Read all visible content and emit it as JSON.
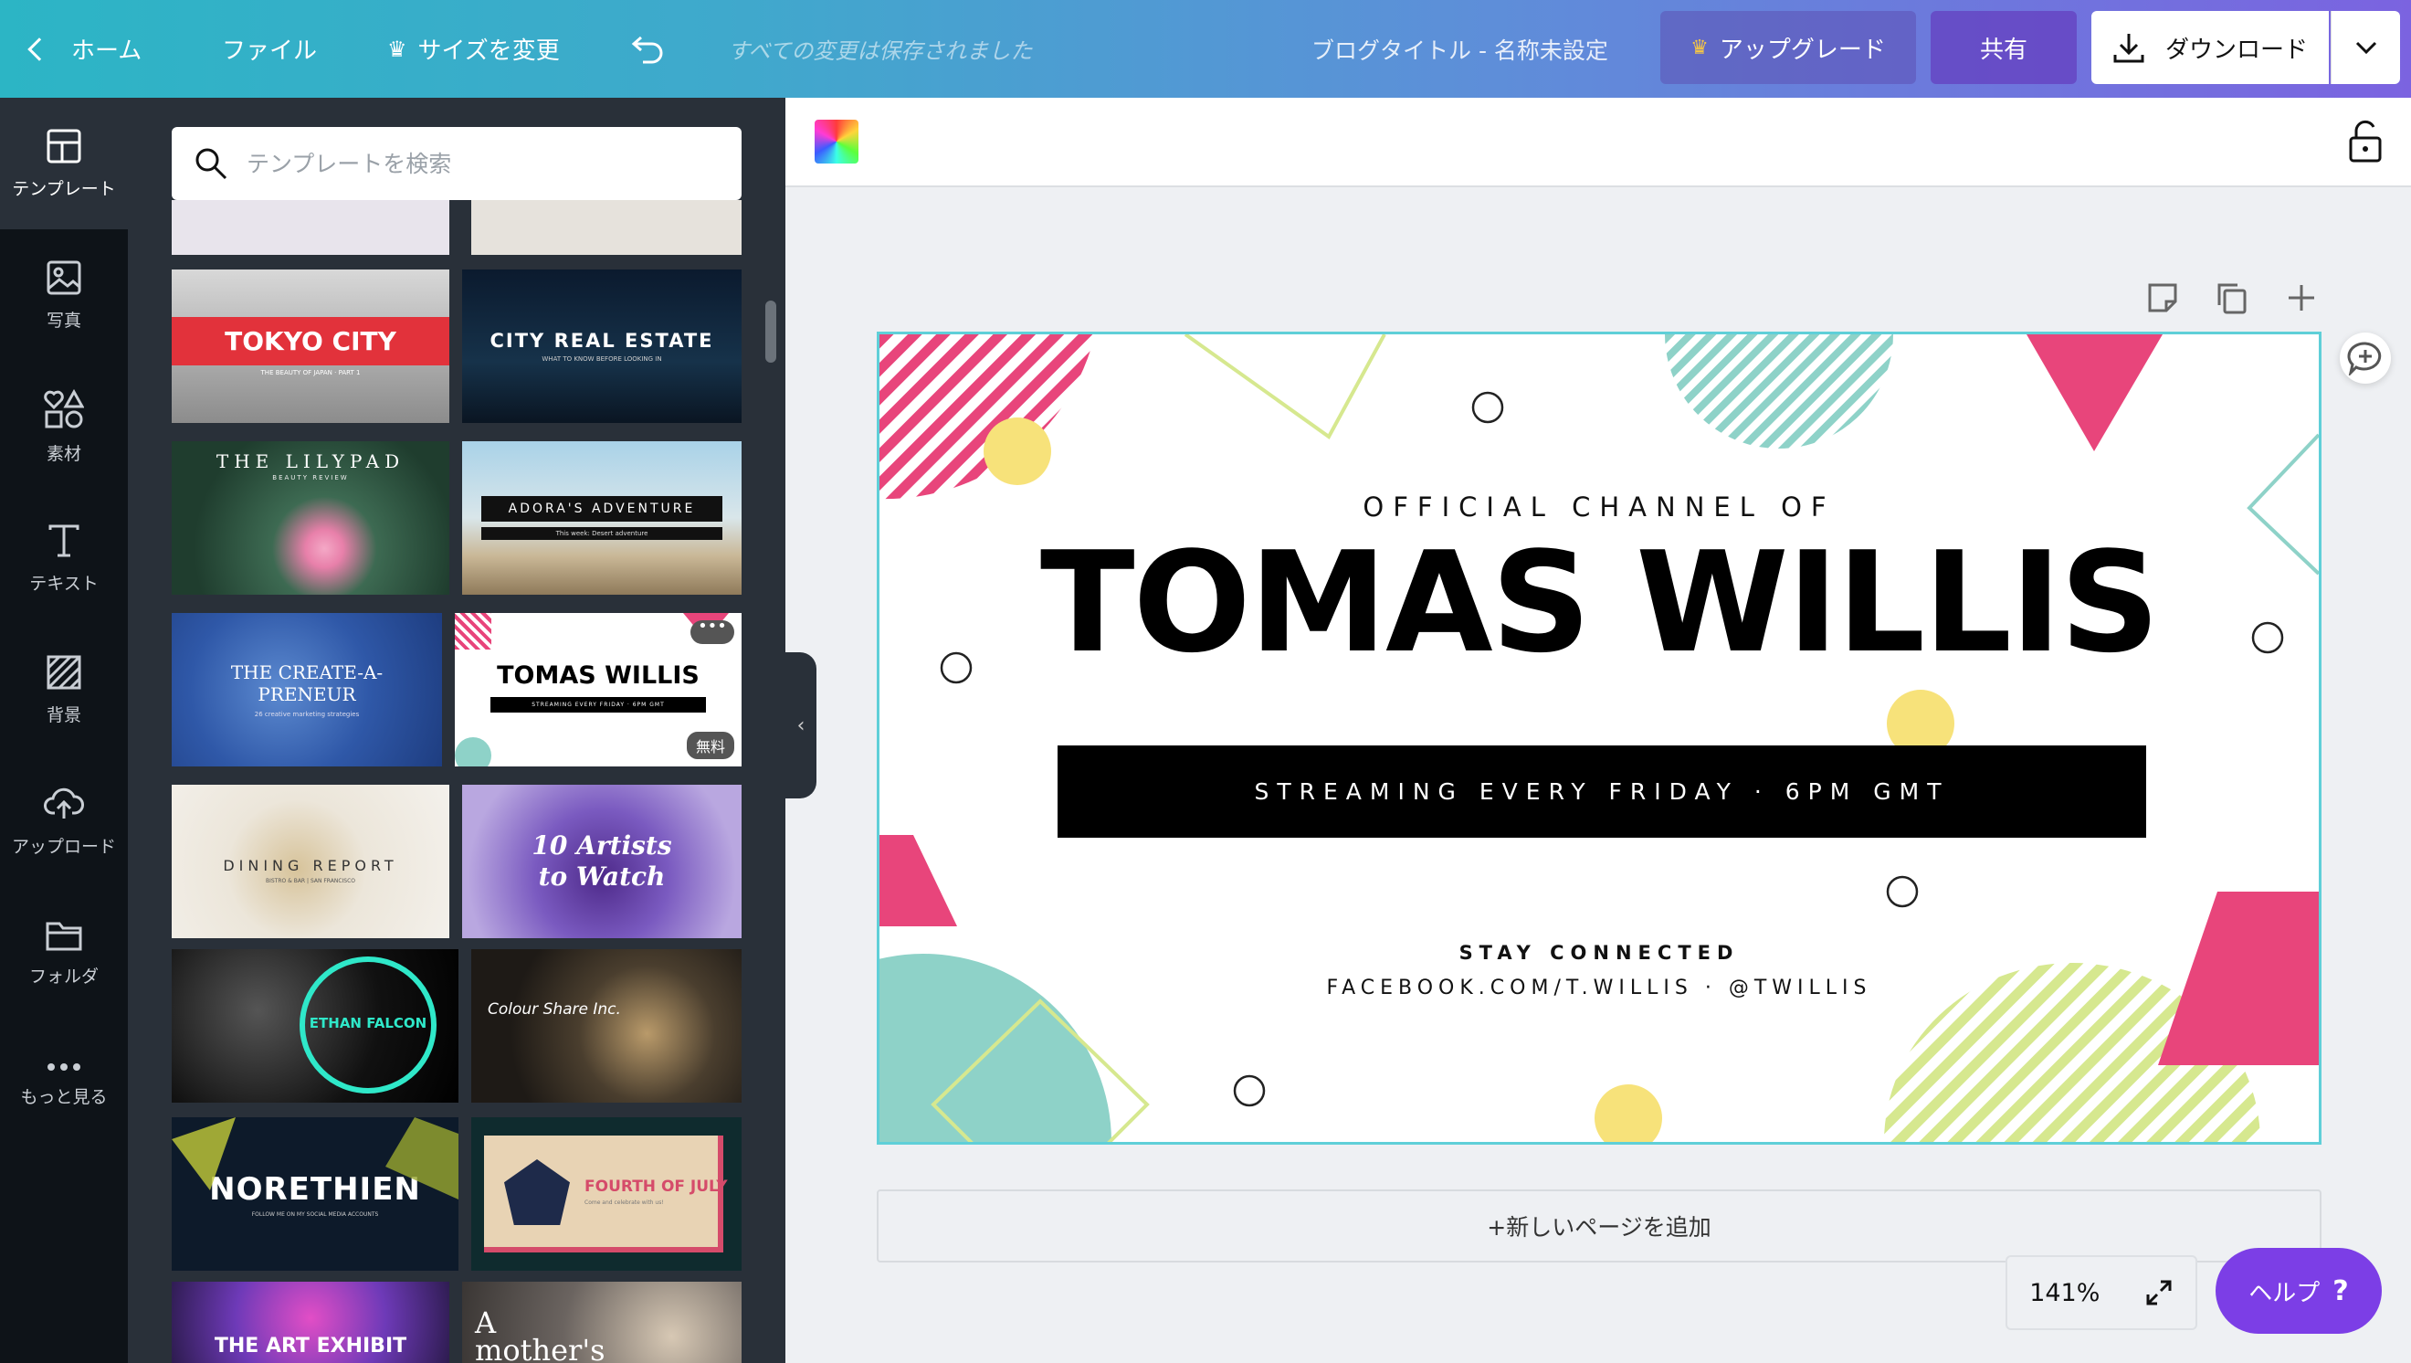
{
  "topbar": {
    "home": "ホーム",
    "file": "ファイル",
    "resize": "サイズを変更",
    "saved_status": "すべての変更は保存されました",
    "doc_title": "ブログタイトル - 名称未設定",
    "upgrade": "アップグレード",
    "share": "共有",
    "download": "ダウンロード"
  },
  "leftnav": [
    {
      "label": "テンプレート",
      "icon": "template-icon"
    },
    {
      "label": "写真",
      "icon": "photo-icon"
    },
    {
      "label": "素材",
      "icon": "elements-icon"
    },
    {
      "label": "テキスト",
      "icon": "text-icon"
    },
    {
      "label": "背景",
      "icon": "background-icon"
    },
    {
      "label": "アップロード",
      "icon": "upload-icon"
    },
    {
      "label": "フォルダ",
      "icon": "folder-icon"
    },
    {
      "label": "もっと見る",
      "icon": "more-icon"
    }
  ],
  "search": {
    "placeholder": "テンプレートを検索"
  },
  "templates": [
    {
      "title": "TOKYO CITY",
      "subtitle": "THE BEAUTY OF JAPAN · PART 1"
    },
    {
      "title": "CITY REAL ESTATE",
      "subtitle": "WHAT TO KNOW BEFORE LOOKING IN"
    },
    {
      "title": "THE LILYPAD",
      "subtitle": "BEAUTY REVIEW"
    },
    {
      "title": "ADORA'S ADVENTURE",
      "subtitle": "This week: Desert adventure"
    },
    {
      "title": "THE CREATE-A-PRENEUR",
      "subtitle": "26 creative marketing strategies"
    },
    {
      "title": "TOMAS WILLIS",
      "subtitle": "STREAMING EVERY FRIDAY · 6PM GMT",
      "badge": "無料"
    },
    {
      "title": "DINING REPORT",
      "subtitle": "BISTRO & BAR | SAN FRANCISCO"
    },
    {
      "title": "10 Artists to Watch",
      "subtitle": ""
    },
    {
      "title": "ETHAN FALCON",
      "subtitle": ""
    },
    {
      "title": "Colour Share Inc.",
      "subtitle": ""
    },
    {
      "title": "NORETHIEN",
      "subtitle": "FOLLOW ME ON MY SOCIAL MEDIA ACCOUNTS"
    },
    {
      "title": "FOURTH OF JULY",
      "subtitle": "Come and celebrate with us!"
    },
    {
      "title": "THE ART EXHIBIT",
      "subtitle": ""
    },
    {
      "title": "A mother's arms",
      "subtitle": ""
    }
  ],
  "canvas": {
    "line1": "OFFICIAL CHANNEL OF",
    "name": "TOMAS WILLIS",
    "banner": "STREAMING EVERY FRIDAY · 6PM GMT",
    "stay": "STAY CONNECTED",
    "social": "FACEBOOK.COM/T.WILLIS · @TWILLIS",
    "colors": {
      "pink": "#e8457b",
      "teal": "#8ed2c8",
      "yellow": "#f7e27a",
      "lime": "#d6e88f",
      "frame": "#5fcfd8"
    }
  },
  "add_page": "+新しいページを追加",
  "zoom": "141%",
  "help": "ヘルプ",
  "help_icon": "?"
}
